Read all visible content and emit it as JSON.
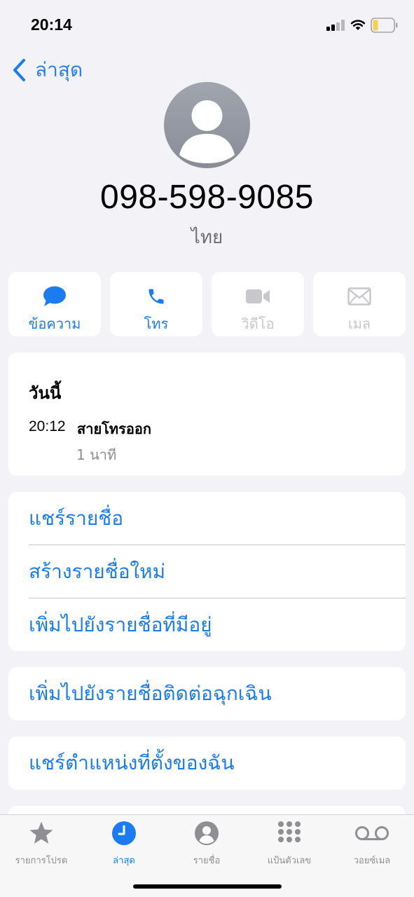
{
  "status_bar": {
    "time": "20:14"
  },
  "nav": {
    "back_label": "ล่าสุด"
  },
  "contact": {
    "number": "098-598-9085",
    "label": "ไทย"
  },
  "actions": [
    {
      "label": "ข้อความ",
      "icon": "message-icon",
      "enabled": true
    },
    {
      "label": "โทร",
      "icon": "phone-icon",
      "enabled": true
    },
    {
      "label": "วิดีโอ",
      "icon": "video-icon",
      "enabled": false
    },
    {
      "label": "เมล",
      "icon": "mail-icon",
      "enabled": false
    }
  ],
  "recent": {
    "day": "วันนี้",
    "time": "20:12",
    "type": "สายโทรออก",
    "duration": "1 นาที"
  },
  "menu": {
    "share_contact": "แชร์รายชื่อ",
    "create_new_contact": "สร้างรายชื่อใหม่",
    "add_to_existing": "เพิ่มไปยังรายชื่อที่มีอยู่",
    "add_emergency": "เพิ่มไปยังรายชื่อติดต่อฉุกเฉิน",
    "share_location": "แชร์ตำแหน่งที่ตั้งของฉัน"
  },
  "tabs": [
    {
      "label": "รายการโปรด",
      "icon": "star-icon"
    },
    {
      "label": "ล่าสุด",
      "icon": "clock-icon",
      "active": true
    },
    {
      "label": "รายชื่อ",
      "icon": "contacts-icon"
    },
    {
      "label": "แป้นตัวเลข",
      "icon": "keypad-icon"
    },
    {
      "label": "วอยซ์เมล",
      "icon": "voicemail-icon"
    }
  ],
  "colors": {
    "accent": "#1a7cf0",
    "background": "#f2f2f7",
    "card": "#ffffff",
    "secondary_text": "#8e8e93",
    "disabled": "#c7c7cc"
  }
}
